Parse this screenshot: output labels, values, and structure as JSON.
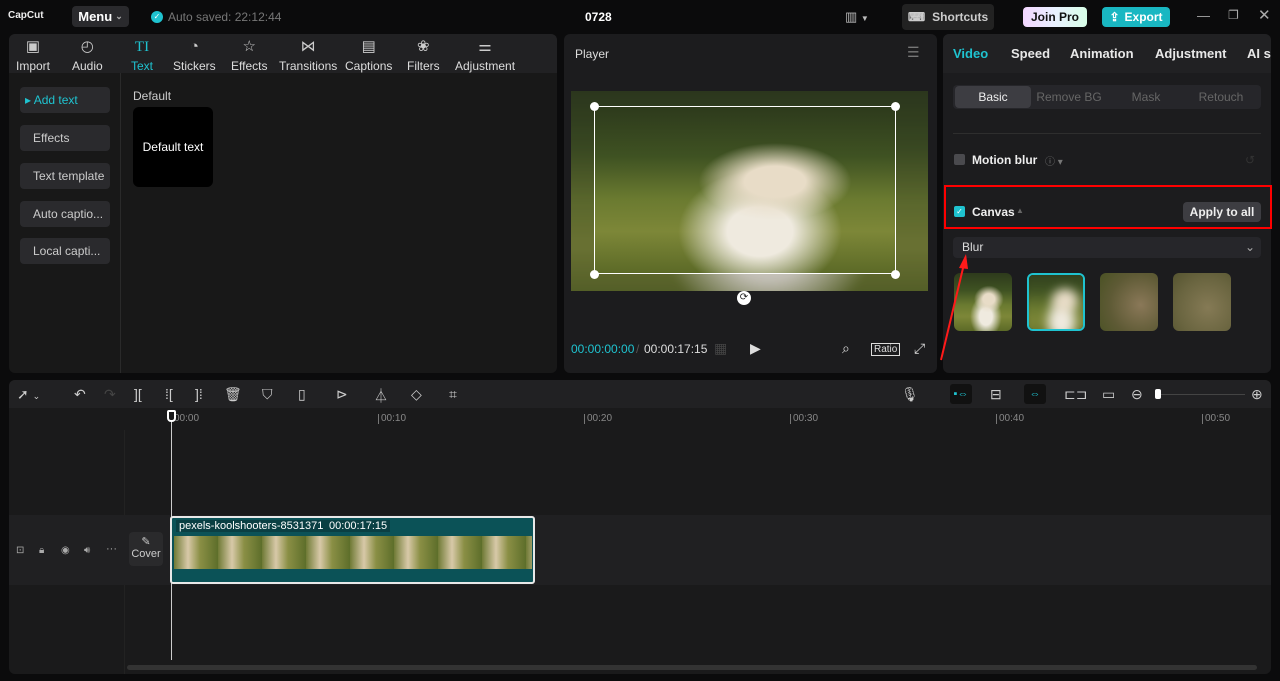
{
  "app": {
    "logo": "CapCut",
    "menu": "Menu",
    "autosave": "Auto saved: 22:12:44",
    "project": "0728",
    "shortcuts": "Shortcuts",
    "join_pro": "Join Pro",
    "export": "Export"
  },
  "media_tabs": [
    {
      "label": "Import",
      "icon": "import-icon"
    },
    {
      "label": "Audio",
      "icon": "audio-icon"
    },
    {
      "label": "Text",
      "icon": "text-icon",
      "active": true
    },
    {
      "label": "Stickers",
      "icon": "sticker-icon"
    },
    {
      "label": "Effects",
      "icon": "effects-icon"
    },
    {
      "label": "Transitions",
      "icon": "transitions-icon"
    },
    {
      "label": "Captions",
      "icon": "captions-icon"
    },
    {
      "label": "Filters",
      "icon": "filters-icon"
    },
    {
      "label": "Adjustment",
      "icon": "adjustment-icon"
    }
  ],
  "text_sidebar": [
    "Add text",
    "Effects",
    "Text template",
    "Auto captio...",
    "Local capti..."
  ],
  "text_content": {
    "section": "Default",
    "card": "Default text"
  },
  "player": {
    "title": "Player",
    "current_time": "00:00:00:00",
    "total_time": "00:00:17:15",
    "ratio": "Ratio"
  },
  "right_panel": {
    "tabs": [
      "Video",
      "Speed",
      "Animation",
      "Adjustment",
      "AI st"
    ],
    "subtabs": [
      "Basic",
      "Remove BG",
      "Mask",
      "Retouch"
    ],
    "motion_blur": "Motion blur",
    "canvas": "Canvas",
    "apply_all": "Apply to all",
    "canvas_type": "Blur",
    "blur_options_selected": 1
  },
  "timeline": {
    "ticks": [
      "00:00",
      "00:10",
      "00:20",
      "00:30",
      "00:40",
      "00:50"
    ],
    "clip_name": "pexels-koolshooters-8531371",
    "clip_duration": "00:00:17:15",
    "cover": "Cover"
  },
  "colors": {
    "accent": "#1fc3d0",
    "highlight": "#ff0000",
    "clip": "#0b5257"
  }
}
